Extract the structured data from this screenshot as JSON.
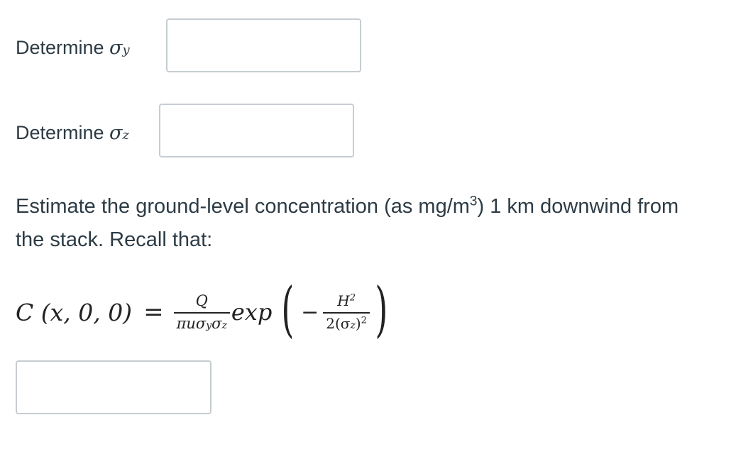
{
  "questions": {
    "q1_prefix": "Determine ",
    "q1_symbol": "σ",
    "q1_subscript": "y",
    "q2_prefix": "Determine ",
    "q2_symbol": "σ",
    "q2_subscript": "z",
    "q3_text_before_sup": "Estimate the ground-level concentration (as mg/m",
    "q3_sup": "3",
    "q3_text_line_rest": ") 1 km downwind from the stack. Recall that:"
  },
  "inputs": {
    "sigma_y_value": "",
    "sigma_z_value": "",
    "concentration_value": ""
  },
  "equation": {
    "lhs_C": "C",
    "lhs_args": "(x, 0, 0)",
    "equals": "=",
    "frac1_num": "Q",
    "frac1_den_pi_u": "πuσ",
    "frac1_den_y": "y",
    "frac1_den_sigma": "σ",
    "frac1_den_z": "z",
    "exp": "exp",
    "left_paren": "(",
    "minus": "−",
    "frac2_num_H": "H",
    "frac2_num_sup": "2",
    "frac2_den_open": "2(σ",
    "frac2_den_sub": "z",
    "frac2_den_close": ")",
    "frac2_den_sup": "2",
    "right_paren": ")"
  }
}
